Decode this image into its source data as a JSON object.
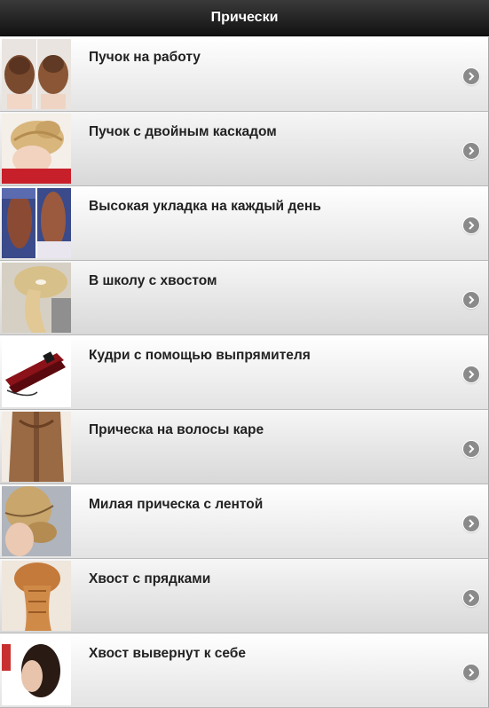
{
  "header": {
    "title": "Прически"
  },
  "list": {
    "items": [
      {
        "label": "Пучок на работу",
        "thumb": "hair-bun-photo"
      },
      {
        "label": "Пучок с двойным каскадом",
        "thumb": "braided-bun-photo"
      },
      {
        "label": "Высокая укладка на каждый день",
        "thumb": "high-updo-photo"
      },
      {
        "label": "В школу с хвостом",
        "thumb": "school-ponytail-photo"
      },
      {
        "label": "Кудри с помощью выпрямителя",
        "thumb": "hair-straightener-photo"
      },
      {
        "label": "Прическа на волосы каре",
        "thumb": "bob-braid-photo"
      },
      {
        "label": "Милая прическа с лентой",
        "thumb": "ribbon-updo-photo"
      },
      {
        "label": "Хвост с прядками",
        "thumb": "strand-ponytail-photo"
      },
      {
        "label": "Хвост вывернут к себе",
        "thumb": "topsy-tail-photo"
      }
    ]
  },
  "colors": {
    "header_bg": "#1a1a1a",
    "header_text": "#ffffff",
    "row_text": "#222222",
    "arrow": "#8a8a8a"
  },
  "icons": {
    "row_arrow": "chevron-right-circle-icon"
  }
}
